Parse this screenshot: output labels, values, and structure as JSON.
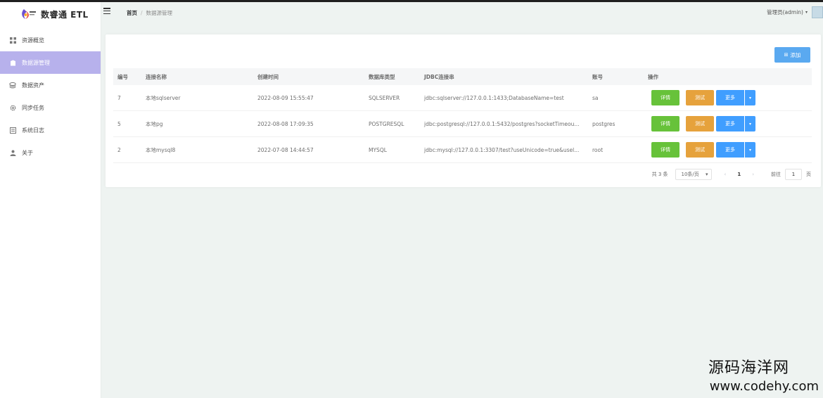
{
  "app": {
    "title": "数睿通 ETL"
  },
  "sidebar": {
    "items": [
      {
        "label": "资源概览",
        "icon": "grid-icon",
        "active": false
      },
      {
        "label": "数据源管理",
        "icon": "database-icon",
        "active": true
      },
      {
        "label": "数据资产",
        "icon": "layers-icon",
        "active": false
      },
      {
        "label": "同步任务",
        "icon": "gear-icon",
        "active": false
      },
      {
        "label": "系统日志",
        "icon": "log-icon",
        "active": false
      },
      {
        "label": "关于",
        "icon": "user-icon",
        "active": false
      }
    ]
  },
  "header": {
    "breadcrumb": {
      "home": "首页",
      "separator": "/",
      "current": "数据源管理"
    },
    "user": "管理员(admin)"
  },
  "toolbar": {
    "add_label": "添加"
  },
  "table": {
    "columns": [
      "编号",
      "连接名称",
      "创建时间",
      "数据库类型",
      "JDBC连接串",
      "账号",
      "操作"
    ],
    "rows": [
      {
        "id": "7",
        "name": "本地sqlserver",
        "created": "2022-08-09 15:55:47",
        "type": "SQLSERVER",
        "jdbc": "jdbc:sqlserver://127.0.0.1:1433;DatabaseName=test",
        "account": "sa"
      },
      {
        "id": "5",
        "name": "本地pg",
        "created": "2022-08-08 17:09:35",
        "type": "POSTGRESQL",
        "jdbc": "jdbc:postgresql://127.0.0.1:5432/postgres?socketTimeou...",
        "account": "postgres"
      },
      {
        "id": "2",
        "name": "本地mysql8",
        "created": "2022-07-08 14:44:57",
        "type": "MYSQL",
        "jdbc": "jdbc:mysql://127.0.0.1:3307/test?useUnicode=true&usel...",
        "account": "root"
      }
    ],
    "actions": {
      "detail": "详情",
      "test": "测试",
      "more": "更多"
    }
  },
  "pagination": {
    "total": "共 3 条",
    "page_size": "10条/页",
    "current_page": "1",
    "goto_prefix": "前往",
    "goto_value": "1",
    "goto_suffix": "页"
  },
  "watermark": {
    "line1": "源码海洋网",
    "line2": "www.codehy.com"
  },
  "colors": {
    "sidebar_active": "#b7b1ec",
    "detail": "#67c23a",
    "test": "#e6a23c",
    "more": "#409eff",
    "add": "#5aa9f0"
  }
}
